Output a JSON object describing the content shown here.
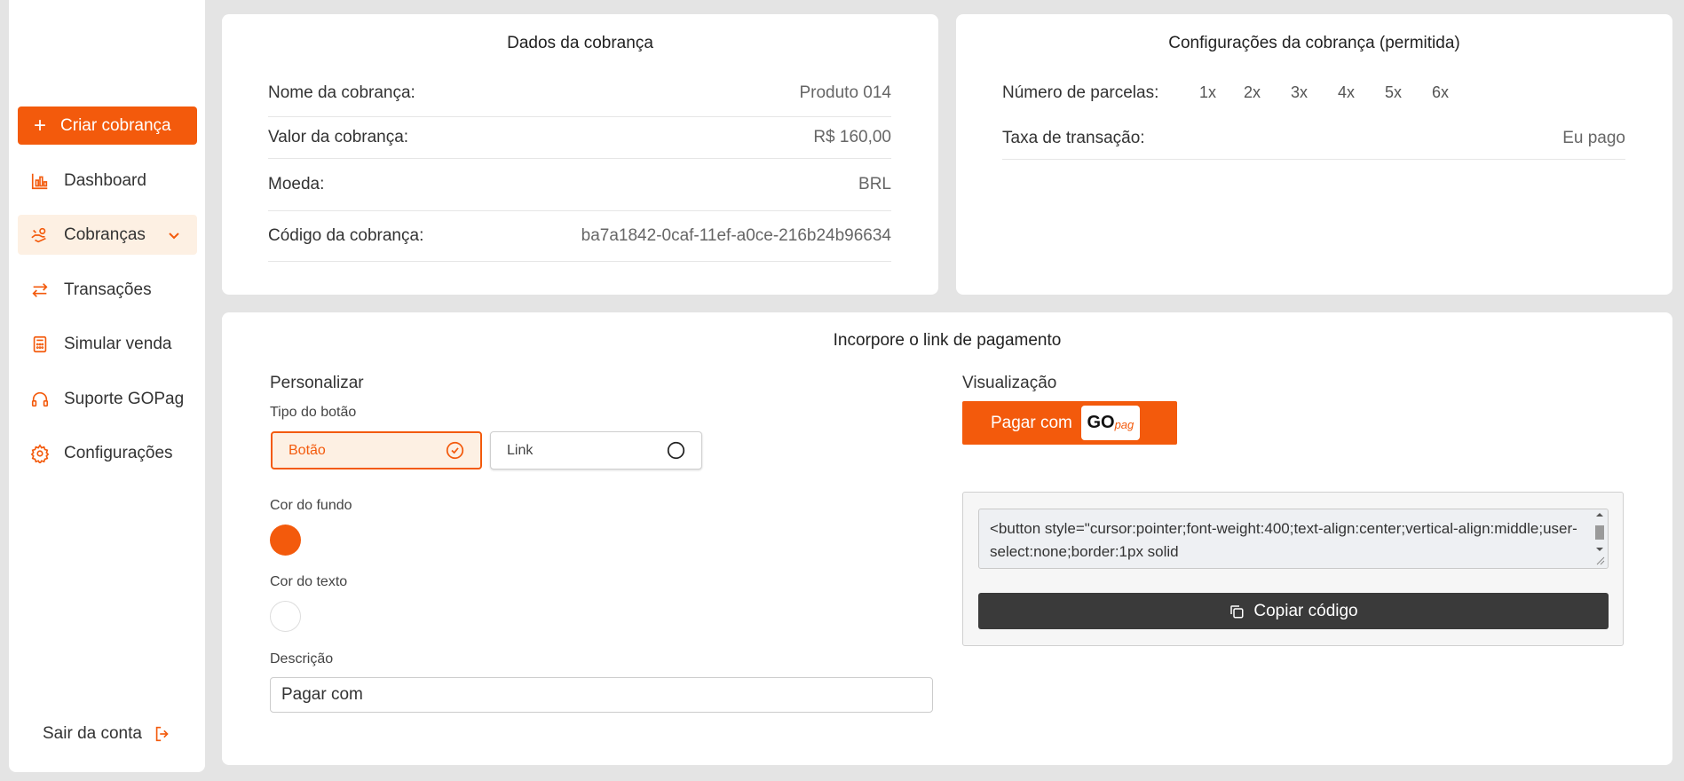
{
  "colors": {
    "accent": "#f35a0c",
    "bg_swatch": "#f35a0c",
    "text_swatch": "#ffffff"
  },
  "sidebar": {
    "create_label": "Criar cobrança",
    "items": [
      {
        "label": "Dashboard",
        "icon": "bar-chart-icon"
      },
      {
        "label": "Cobranças",
        "icon": "hand-money-icon"
      },
      {
        "label": "Transações",
        "icon": "arrows-swap-icon"
      },
      {
        "label": "Simular venda",
        "icon": "calculator-icon"
      },
      {
        "label": "Suporte GOPag",
        "icon": "headset-icon"
      },
      {
        "label": "Configurações",
        "icon": "gear-icon"
      }
    ],
    "logout_label": "Sair da conta"
  },
  "charge_data": {
    "title": "Dados da cobrança",
    "rows": [
      {
        "label": "Nome da cobrança:",
        "value": "Produto 014"
      },
      {
        "label": "Valor da cobrança:",
        "value": "R$ 160,00"
      },
      {
        "label": "Moeda:",
        "value": "BRL"
      },
      {
        "label": "Código da cobrança:",
        "value": "ba7a1842-0caf-11ef-a0ce-216b24b96634"
      }
    ]
  },
  "charge_config": {
    "title": "Configurações da cobrança (permitida)",
    "installments_label": "Número de parcelas:",
    "installments": [
      "1x",
      "2x",
      "3x",
      "4x",
      "5x",
      "6x"
    ],
    "fee_label": "Taxa de transação:",
    "fee_value": "Eu pago"
  },
  "embed": {
    "title": "Incorpore o link de pagamento",
    "customize_label": "Personalizar",
    "button_type_label": "Tipo do botão",
    "option_button": "Botão",
    "option_link": "Link",
    "bg_color_label": "Cor do fundo",
    "text_color_label": "Cor do texto",
    "description_label": "Descrição",
    "description_value": "Pagar com",
    "preview_label": "Visualização",
    "preview_button_text": "Pagar com",
    "logo_go": "GO",
    "logo_pag": "pag",
    "code_text": "<button style=\"cursor:pointer;font-weight:400;text-align:center;vertical-align:middle;user-select:none;border:1px solid",
    "copy_label": "Copiar código"
  }
}
